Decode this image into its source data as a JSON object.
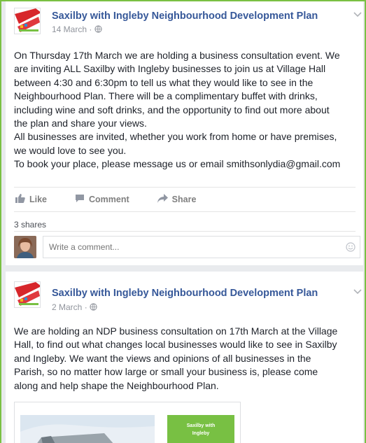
{
  "colors": {
    "link": "#365899",
    "frame_green": "#7ac043",
    "muted": "#90949c"
  },
  "posts": [
    {
      "page_name": "Saxilby with Ingleby Neighbourhood Development Plan",
      "date": "14 March",
      "body_lines": [
        "On Thursday 17th March we are holding a business consultation event. We",
        "are inviting ALL Saxilby with Ingleby businesses to join us at Village Hall",
        "between 4:30 and 6:30pm to tell us what they would like to see in the",
        "Neighbourhood Plan. There will be a complimentary buffet with drinks,",
        "including wine and soft drinks, and the opportunity to find out more about",
        "the plan and share your views.",
        "All businesses are invited, whether you work from home or have premises,",
        "we would love to see you.",
        "To book your place, please message us or email smithsonlydia@gmail.com"
      ],
      "actions": {
        "like": "Like",
        "comment": "Comment",
        "share": "Share"
      },
      "shares": "3 shares",
      "comment_placeholder": "Write a comment..."
    },
    {
      "page_name": "Saxilby with Ingleby Neighbourhood Development Plan",
      "date": "2 March",
      "body_lines": [
        "We are holding an NDP business consultation on 17th March at the Village",
        "Hall, to find out what changes local businesses would like to see in Saxilby",
        "and Ingleby. We want the views and opinions of all businesses in the",
        "Parish, so no matter how large or small your business is, please come",
        "along and help shape the Neighbourhood Plan."
      ],
      "preview_text": [
        "Saxilby with",
        "Ingleby"
      ]
    }
  ],
  "icons": [
    "page-logo-icon",
    "globe-icon",
    "chevron-down-icon",
    "like-icon",
    "comment-icon",
    "share-icon",
    "emoji-icon"
  ]
}
